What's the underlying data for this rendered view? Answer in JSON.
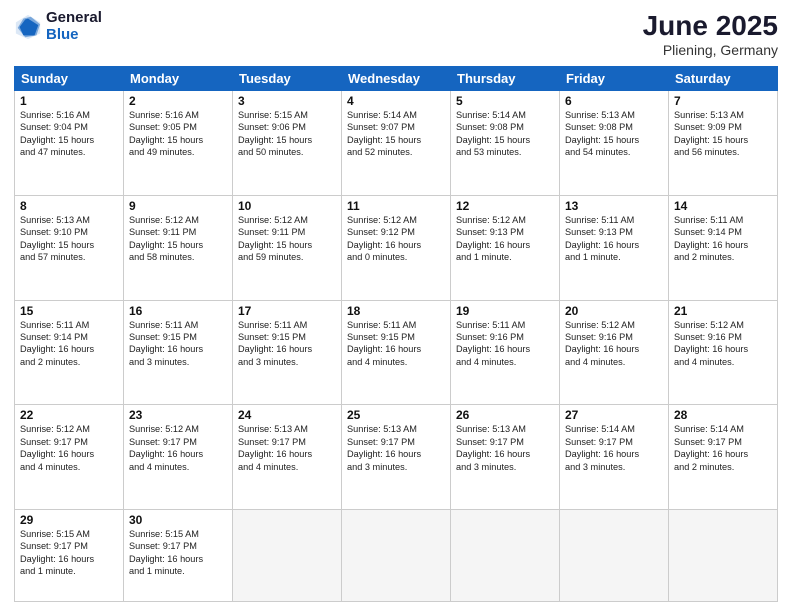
{
  "header": {
    "logo_general": "General",
    "logo_blue": "Blue",
    "title": "June 2025",
    "subtitle": "Pliening, Germany"
  },
  "columns": [
    "Sunday",
    "Monday",
    "Tuesday",
    "Wednesday",
    "Thursday",
    "Friday",
    "Saturday"
  ],
  "weeks": [
    [
      {
        "day": "1",
        "info": "Sunrise: 5:16 AM\nSunset: 9:04 PM\nDaylight: 15 hours\nand 47 minutes."
      },
      {
        "day": "2",
        "info": "Sunrise: 5:16 AM\nSunset: 9:05 PM\nDaylight: 15 hours\nand 49 minutes."
      },
      {
        "day": "3",
        "info": "Sunrise: 5:15 AM\nSunset: 9:06 PM\nDaylight: 15 hours\nand 50 minutes."
      },
      {
        "day": "4",
        "info": "Sunrise: 5:14 AM\nSunset: 9:07 PM\nDaylight: 15 hours\nand 52 minutes."
      },
      {
        "day": "5",
        "info": "Sunrise: 5:14 AM\nSunset: 9:08 PM\nDaylight: 15 hours\nand 53 minutes."
      },
      {
        "day": "6",
        "info": "Sunrise: 5:13 AM\nSunset: 9:08 PM\nDaylight: 15 hours\nand 54 minutes."
      },
      {
        "day": "7",
        "info": "Sunrise: 5:13 AM\nSunset: 9:09 PM\nDaylight: 15 hours\nand 56 minutes."
      }
    ],
    [
      {
        "day": "8",
        "info": "Sunrise: 5:13 AM\nSunset: 9:10 PM\nDaylight: 15 hours\nand 57 minutes."
      },
      {
        "day": "9",
        "info": "Sunrise: 5:12 AM\nSunset: 9:11 PM\nDaylight: 15 hours\nand 58 minutes."
      },
      {
        "day": "10",
        "info": "Sunrise: 5:12 AM\nSunset: 9:11 PM\nDaylight: 15 hours\nand 59 minutes."
      },
      {
        "day": "11",
        "info": "Sunrise: 5:12 AM\nSunset: 9:12 PM\nDaylight: 16 hours\nand 0 minutes."
      },
      {
        "day": "12",
        "info": "Sunrise: 5:12 AM\nSunset: 9:13 PM\nDaylight: 16 hours\nand 1 minute."
      },
      {
        "day": "13",
        "info": "Sunrise: 5:11 AM\nSunset: 9:13 PM\nDaylight: 16 hours\nand 1 minute."
      },
      {
        "day": "14",
        "info": "Sunrise: 5:11 AM\nSunset: 9:14 PM\nDaylight: 16 hours\nand 2 minutes."
      }
    ],
    [
      {
        "day": "15",
        "info": "Sunrise: 5:11 AM\nSunset: 9:14 PM\nDaylight: 16 hours\nand 2 minutes."
      },
      {
        "day": "16",
        "info": "Sunrise: 5:11 AM\nSunset: 9:15 PM\nDaylight: 16 hours\nand 3 minutes."
      },
      {
        "day": "17",
        "info": "Sunrise: 5:11 AM\nSunset: 9:15 PM\nDaylight: 16 hours\nand 3 minutes."
      },
      {
        "day": "18",
        "info": "Sunrise: 5:11 AM\nSunset: 9:15 PM\nDaylight: 16 hours\nand 4 minutes."
      },
      {
        "day": "19",
        "info": "Sunrise: 5:11 AM\nSunset: 9:16 PM\nDaylight: 16 hours\nand 4 minutes."
      },
      {
        "day": "20",
        "info": "Sunrise: 5:12 AM\nSunset: 9:16 PM\nDaylight: 16 hours\nand 4 minutes."
      },
      {
        "day": "21",
        "info": "Sunrise: 5:12 AM\nSunset: 9:16 PM\nDaylight: 16 hours\nand 4 minutes."
      }
    ],
    [
      {
        "day": "22",
        "info": "Sunrise: 5:12 AM\nSunset: 9:17 PM\nDaylight: 16 hours\nand 4 minutes."
      },
      {
        "day": "23",
        "info": "Sunrise: 5:12 AM\nSunset: 9:17 PM\nDaylight: 16 hours\nand 4 minutes."
      },
      {
        "day": "24",
        "info": "Sunrise: 5:13 AM\nSunset: 9:17 PM\nDaylight: 16 hours\nand 4 minutes."
      },
      {
        "day": "25",
        "info": "Sunrise: 5:13 AM\nSunset: 9:17 PM\nDaylight: 16 hours\nand 3 minutes."
      },
      {
        "day": "26",
        "info": "Sunrise: 5:13 AM\nSunset: 9:17 PM\nDaylight: 16 hours\nand 3 minutes."
      },
      {
        "day": "27",
        "info": "Sunrise: 5:14 AM\nSunset: 9:17 PM\nDaylight: 16 hours\nand 3 minutes."
      },
      {
        "day": "28",
        "info": "Sunrise: 5:14 AM\nSunset: 9:17 PM\nDaylight: 16 hours\nand 2 minutes."
      }
    ],
    [
      {
        "day": "29",
        "info": "Sunrise: 5:15 AM\nSunset: 9:17 PM\nDaylight: 16 hours\nand 1 minute."
      },
      {
        "day": "30",
        "info": "Sunrise: 5:15 AM\nSunset: 9:17 PM\nDaylight: 16 hours\nand 1 minute."
      },
      {
        "day": "",
        "info": ""
      },
      {
        "day": "",
        "info": ""
      },
      {
        "day": "",
        "info": ""
      },
      {
        "day": "",
        "info": ""
      },
      {
        "day": "",
        "info": ""
      }
    ]
  ]
}
